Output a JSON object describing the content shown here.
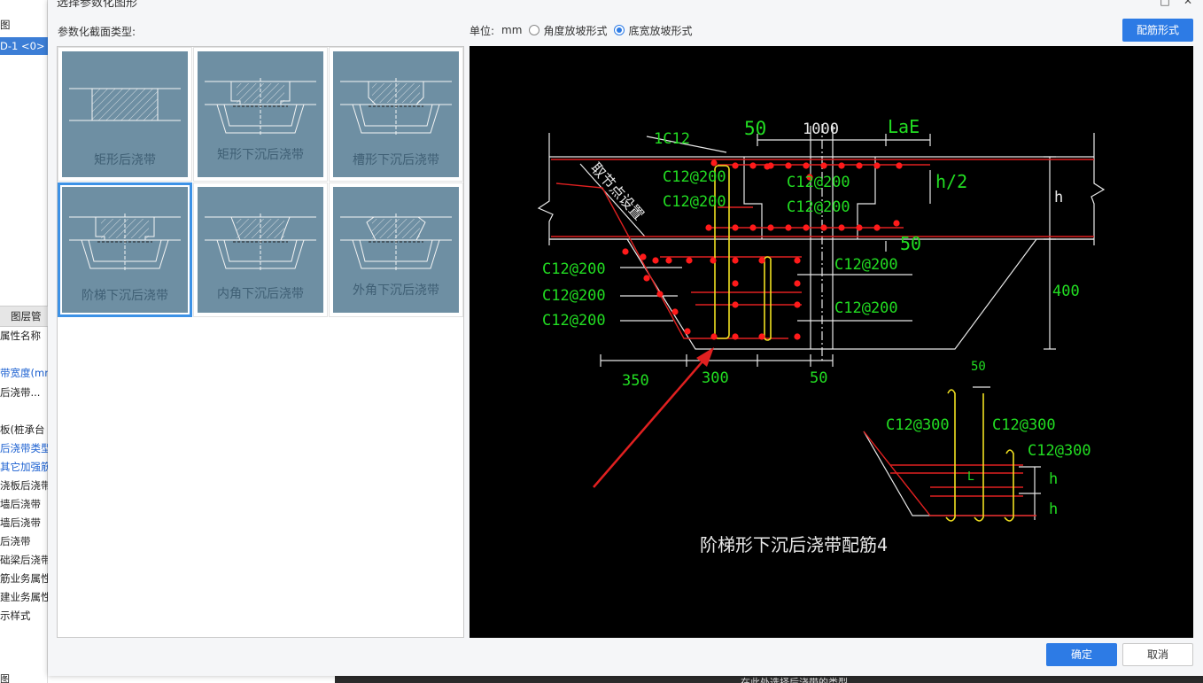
{
  "background": {
    "left_rows": [
      {
        "text": "图",
        "cls": ""
      },
      {
        "text": "D-1 <0>",
        "cls": "sel"
      }
    ],
    "tab_label": "图层管",
    "prop_header": "属性名称",
    "prop_rows": [
      {
        "text": "带宽度(mm",
        "cls": "blue"
      },
      {
        "text": "后浇带...",
        "cls": ""
      },
      {
        "text": "",
        "cls": ""
      },
      {
        "text": "板(桩承台",
        "cls": ""
      },
      {
        "text": "后浇带类型",
        "cls": "blue"
      },
      {
        "text": "其它加强筋",
        "cls": "blue"
      },
      {
        "text": "浇板后浇带",
        "cls": ""
      },
      {
        "text": "墙后浇带",
        "cls": ""
      },
      {
        "text": "墙后浇带",
        "cls": ""
      },
      {
        "text": "后浇带",
        "cls": ""
      },
      {
        "text": "础梁后浇带",
        "cls": ""
      },
      {
        "text": "筋业务属性",
        "cls": ""
      },
      {
        "text": "建业务属性",
        "cls": ""
      },
      {
        "text": "示样式",
        "cls": ""
      }
    ],
    "bottom_text": "在此处选择后浇带的类型",
    "bottom_left": "图"
  },
  "dialog": {
    "title": "选择参数化图形",
    "section_label": "参数化截面类型:",
    "unit_label": "单位:",
    "unit_value": "mm",
    "radio_angle": "角度放坡形式",
    "radio_width": "底宽放坡形式",
    "rebar_button": "配筋形式",
    "ok_button": "确定",
    "cancel_button": "取消"
  },
  "shapes": [
    {
      "label": "矩形后浇带",
      "name": "shape-rect",
      "selected": false
    },
    {
      "label": "矩形下沉后浇带",
      "name": "shape-rect-sunken",
      "selected": false
    },
    {
      "label": "槽形下沉后浇带",
      "name": "shape-trough-sunken",
      "selected": false
    },
    {
      "label": "阶梯下沉后浇带",
      "name": "shape-step-sunken",
      "selected": true
    },
    {
      "label": "内角下沉后浇带",
      "name": "shape-inner-angle-sunken",
      "selected": false
    },
    {
      "label": "外角下沉后浇带",
      "name": "shape-outer-angle-sunken",
      "selected": false
    }
  ],
  "cad": {
    "caption": "阶梯形下沉后浇带配筋4",
    "slant_text": "取节点设置",
    "labels": {
      "l1c12": "1C12",
      "d50a": "50",
      "d1000": "1000",
      "lae": "LaE",
      "c1": "C12@200",
      "c2": "C12@200",
      "c3": "C12@200",
      "c4": "C12@200",
      "h2": "h/2",
      "h": "h",
      "d50b": "50",
      "c5": "C12@200",
      "c6": "C12@200",
      "c7": "C12@200",
      "c8": "C12@200",
      "c9": "C12@200",
      "d400": "400",
      "d350": "350",
      "d300": "300",
      "d50c": "50",
      "d50d": "50",
      "c300a": "C12@300",
      "c300b": "C12@300",
      "c300c": "C12@300",
      "hd1": "h",
      "hd2": "h",
      "lL": "L"
    }
  }
}
